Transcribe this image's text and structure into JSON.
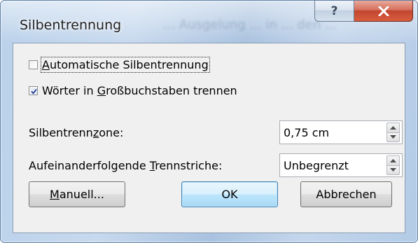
{
  "window": {
    "title": "Silbentrennung",
    "background_text": "... Ausgelung ... in ... den ...",
    "help_label": "?",
    "close_icon": "close-icon"
  },
  "options": {
    "auto_hyphenation": {
      "pre": "",
      "accel": "A",
      "post": "utomatische Silbentrennung",
      "checked": false
    },
    "caps_hyphenate": {
      "pre": "Wörter in ",
      "accel": "G",
      "post": "roßbuchstaben trennen",
      "checked": true
    }
  },
  "fields": {
    "zone": {
      "label_pre": "Silbentrenn",
      "label_accel": "z",
      "label_post": "one:",
      "value": "0,75 cm"
    },
    "consecutive": {
      "label_pre": "Aufeinanderfolgende ",
      "label_accel": "T",
      "label_post": "rennstriche:",
      "value": "Unbegrenzt"
    }
  },
  "buttons": {
    "manual": {
      "accel": "M",
      "rest": "anuell..."
    },
    "ok": "OK",
    "cancel": "Abbrechen"
  },
  "colors": {
    "frame": "#b9d1ea",
    "client": "#f0f0f0",
    "close_button": "#c2452f",
    "default_button_border": "#3c7fb1"
  }
}
